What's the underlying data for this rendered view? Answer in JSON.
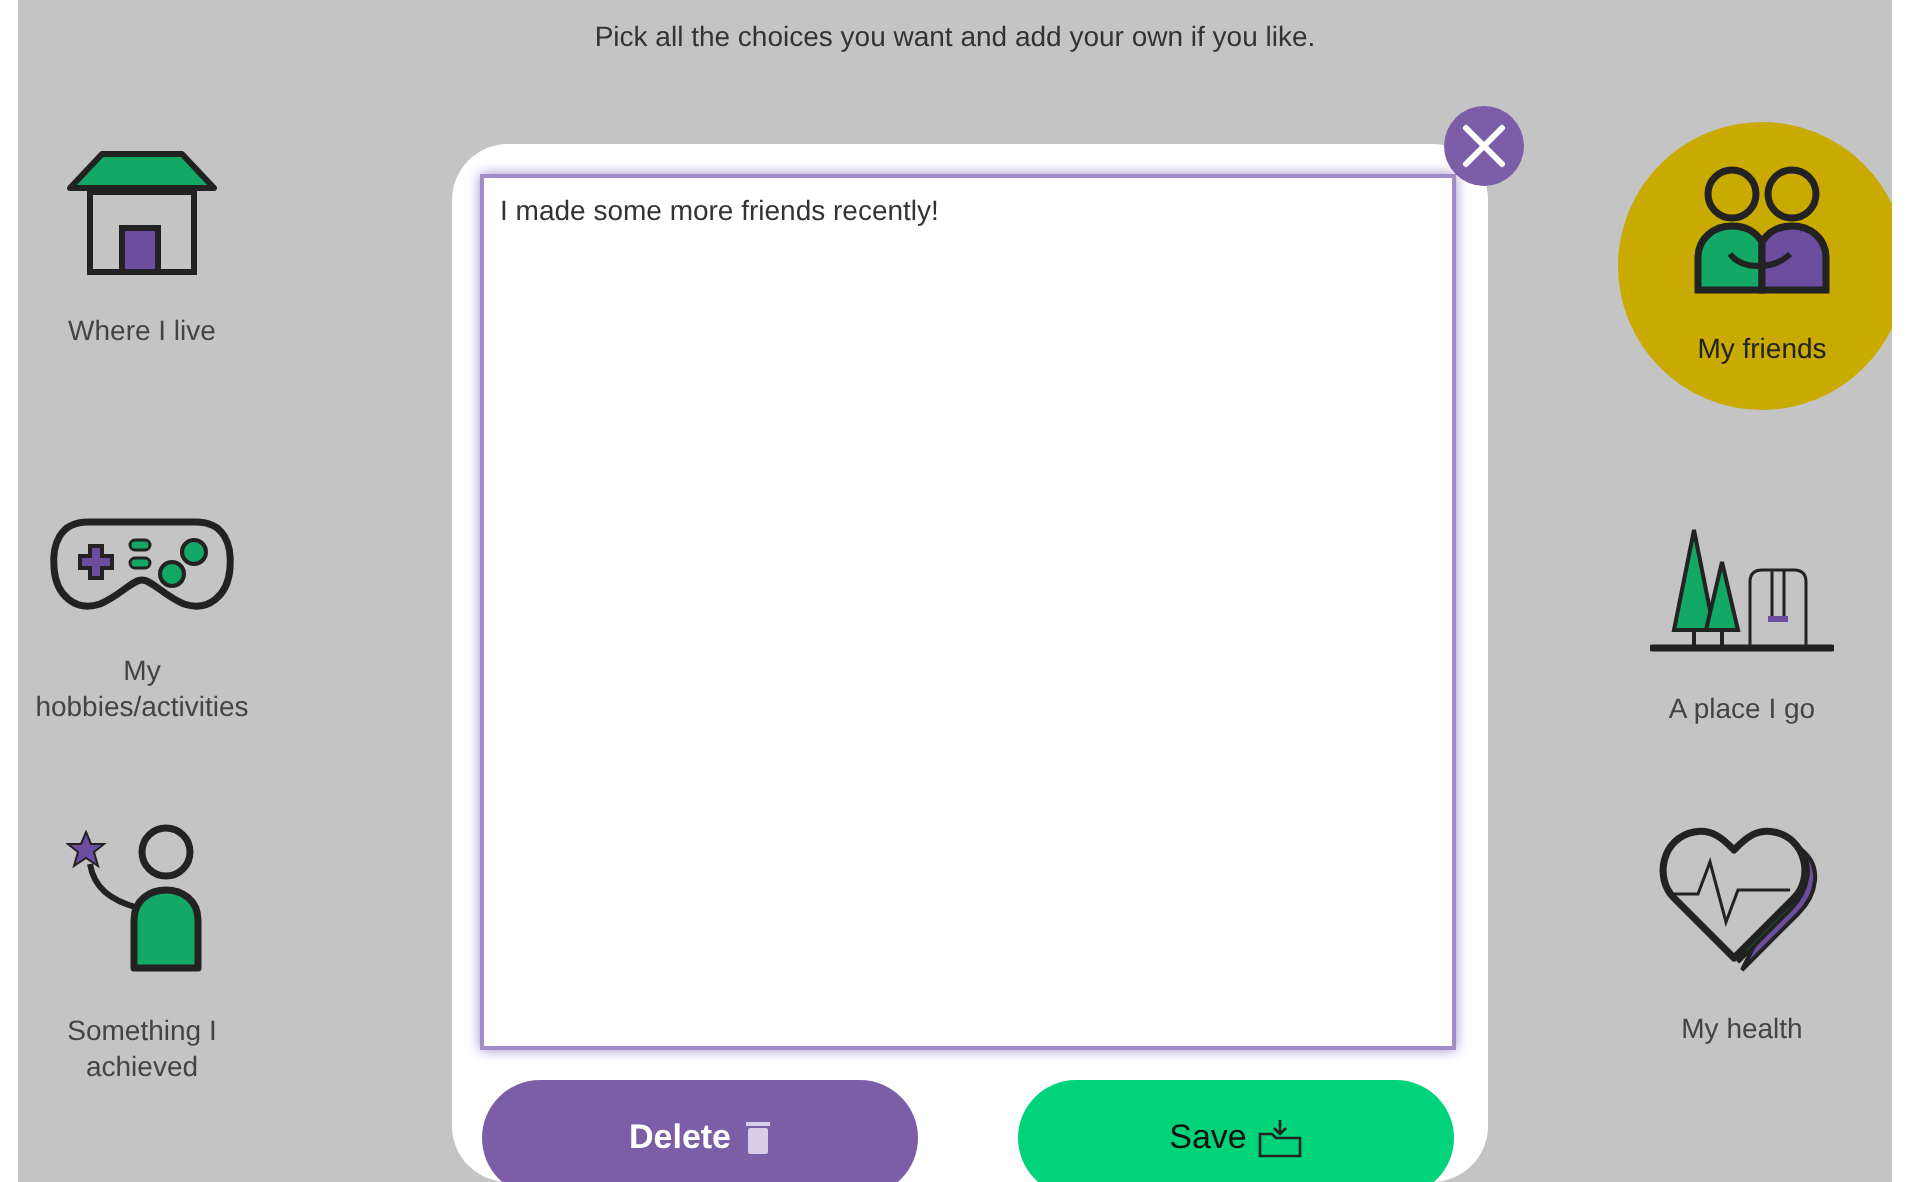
{
  "instruction": "Pick all the choices you want and add your own if you like.",
  "left_choices": [
    {
      "kind": "house",
      "label": "Where I live",
      "selected": false
    },
    {
      "kind": "gamepad",
      "label": "My\nhobbies/activities",
      "selected": false
    },
    {
      "kind": "achiever",
      "label": "Something I\nachieved",
      "selected": false
    }
  ],
  "right_choices": [
    {
      "kind": "friends",
      "label": "My friends",
      "selected": true
    },
    {
      "kind": "park",
      "label": "A place I go",
      "selected": false
    },
    {
      "kind": "heart",
      "label": "My health",
      "selected": false
    }
  ],
  "dialog": {
    "text": "I made some more friends recently!",
    "delete_label": "Delete",
    "save_label": "Save"
  }
}
